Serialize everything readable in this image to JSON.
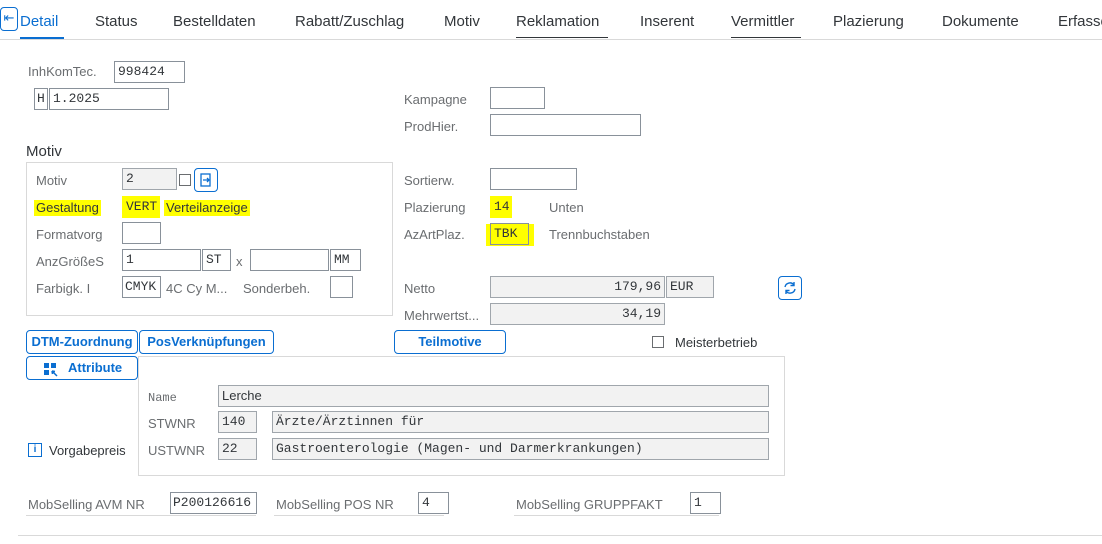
{
  "tabs": [
    {
      "label": "Detail"
    },
    {
      "label": "Status"
    },
    {
      "label": "Bestelldaten"
    },
    {
      "label": "Rabatt/Zuschlag"
    },
    {
      "label": "Motiv"
    },
    {
      "label": "Reklamation"
    },
    {
      "label": "Inserent"
    },
    {
      "label": "Vermittler"
    },
    {
      "label": "Plazierung"
    },
    {
      "label": "Dokumente"
    },
    {
      "label": "Erfasse"
    }
  ],
  "header": {
    "inhkomtec_label": "InhKomTec.",
    "inhkomtec_value": "998424",
    "h_value": "H",
    "date_value": "1.2025",
    "kampagne_label": "Kampagne",
    "kampagne_value": "",
    "prodhier_label": "ProdHier.",
    "prodhier_value": ""
  },
  "motiv": {
    "section_title": "Motiv",
    "motiv_label": "Motiv",
    "motiv_value": "2",
    "gestaltung_label": "Gestaltung",
    "gestaltung_value": "VERT",
    "gestaltung_text": "Verteilanzeige",
    "formatvorg_label": "Formatvorg",
    "formatvorg_value": "",
    "anzgroesse_label": "AnzGrößeS",
    "anzgroesse_value": "1",
    "anzgroesse_unit": "ST",
    "times_sign": "x",
    "anzgroesse_value2": "",
    "anzgroesse_unit2": "MM",
    "farbigk_label": "Farbigk. I",
    "farbigk_value": "CMYK",
    "farbigk_text": "4C Cy M...",
    "sonderbeh_label": "Sonderbeh.",
    "sonderbeh_value": ""
  },
  "right": {
    "sortierw_label": "Sortierw.",
    "sortierw_value": "",
    "plazierung_label": "Plazierung",
    "plazierung_value": "14",
    "plazierung_text": "Unten",
    "azartplaz_label": "AzArtPlaz.",
    "azartplaz_value": "TBK",
    "azartplaz_text": "Trennbuchstaben",
    "netto_label": "Netto",
    "netto_value": "179,96",
    "netto_currency": "EUR",
    "mwst_label": "Mehrwertst...",
    "mwst_value": "34,19"
  },
  "buttons": {
    "dtm": "DTM-Zuordnung",
    "posverk": "PosVerknüpfungen",
    "teilmotive": "Teilmotive",
    "attribute": "Attribute",
    "meisterbetrieb": "Meisterbetrieb"
  },
  "attributes": {
    "name_label": "Name",
    "name_value": "Lerche",
    "stwnr_label": "STWNR",
    "stwnr_value": "140",
    "stwnr_text": "Ärzte/Ärztinnen für",
    "ustwnr_label": "USTWNR",
    "ustwnr_value": "22",
    "ustwnr_text": "Gastroenterologie (Magen- und Darmerkrankungen)",
    "vorgabepreis_label": "Vorgabepreis"
  },
  "footer": {
    "avm_label": "MobSelling AVM NR",
    "avm_value": "P200126616",
    "pos_label": "MobSelling POS NR",
    "pos_value": "4",
    "gruppfakt_label": "MobSelling GRUPPFAKT",
    "gruppfakt_value": "1"
  },
  "icons": {
    "corner": "collapse-icon",
    "motiv_action": "export-icon",
    "refresh": "refresh-icon",
    "attribute": "grid-icon",
    "info": "info-icon"
  },
  "colors": {
    "accent": "#0a6ed1",
    "highlight": "#ffff00"
  }
}
